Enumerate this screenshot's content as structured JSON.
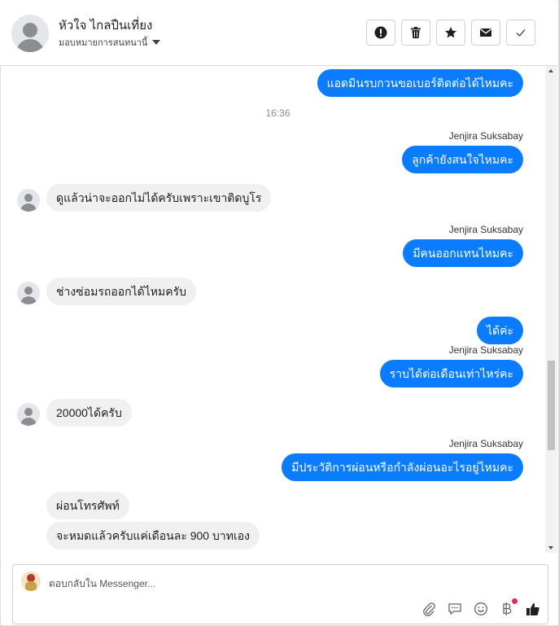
{
  "header": {
    "contact_name": "หัวใจ ไกลปืนเที่ยง",
    "assign_label": "มอบหมายการสนทนานี้",
    "actions": [
      "report-icon",
      "trash-icon",
      "star-icon",
      "envelope-icon",
      "check-icon"
    ]
  },
  "thread": {
    "messages": [
      {
        "type": "out",
        "text": "แอดมินรบกวนขอเบอร์ติดต่อได้ไหมคะ"
      },
      {
        "type": "time",
        "text": "16:36"
      },
      {
        "type": "sender",
        "text": "Jenjira Suksabay"
      },
      {
        "type": "out",
        "text": "ลูกค้ายังสนใจไหมคะ"
      },
      {
        "type": "in",
        "text": "ดูแล้วน่าจะออกไม่ได้ครับเพราะเขาติดบูโร"
      },
      {
        "type": "sender",
        "text": "Jenjira Suksabay"
      },
      {
        "type": "out",
        "text": "มีคนออกแทนไหมคะ"
      },
      {
        "type": "in",
        "text": "ช่างซ่อมรถออกได้ไหมครับ"
      },
      {
        "type": "out",
        "text": "ได้ค่ะ"
      },
      {
        "type": "sender",
        "text": "Jenjira Suksabay"
      },
      {
        "type": "out",
        "text": "ราบได้ต่อเดือนเท่าไหร่คะ"
      },
      {
        "type": "in",
        "text": "20000ได้ครับ"
      },
      {
        "type": "sender",
        "text": "Jenjira Suksabay"
      },
      {
        "type": "out",
        "text": "มีประวัติการผ่อนหรือกำลังผ่อนอะไรอยู่ไหมคะ"
      },
      {
        "type": "in",
        "text": "ผ่อนโทรศัพท์"
      },
      {
        "type": "in",
        "text": "จะหมดแล้วครับแค่เดือนละ 900 บาทเอง"
      }
    ]
  },
  "composer": {
    "placeholder": "ตอบกลับใน Messenger...",
    "tools": [
      "paperclip-icon",
      "saved-reply-icon",
      "emoji-icon",
      "baht-icon",
      "thumbs-up-icon"
    ]
  },
  "colors": {
    "outgoing_bubble": "#0a7cff",
    "incoming_bubble": "#f0f0f0",
    "notification_dot": "#f02849"
  }
}
